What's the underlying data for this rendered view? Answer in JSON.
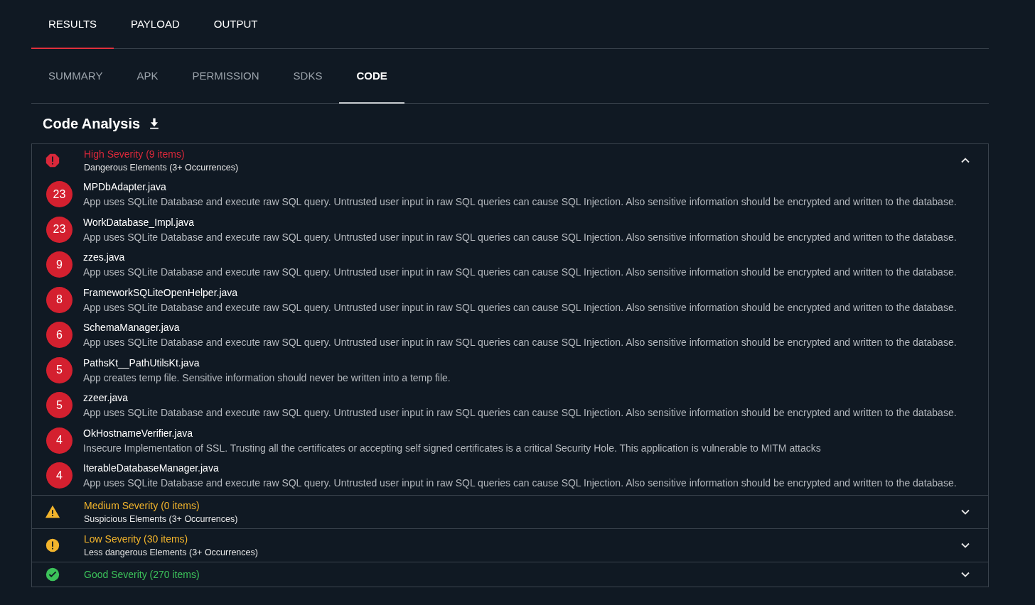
{
  "tabs": [
    {
      "label": "RESULTS",
      "selected": true
    },
    {
      "label": "PAYLOAD",
      "selected": false
    },
    {
      "label": "OUTPUT",
      "selected": false
    }
  ],
  "subtabs": [
    {
      "label": "SUMMARY",
      "selected": false
    },
    {
      "label": "APK",
      "selected": false
    },
    {
      "label": "PERMISSION",
      "selected": false
    },
    {
      "label": "SDKS",
      "selected": false
    },
    {
      "label": "CODE",
      "selected": true
    }
  ],
  "heading": "Code Analysis",
  "sections": [
    {
      "kind": "high",
      "title": "High Severity (9 items)",
      "subtitle": "Dangerous Elements (3+ Occurrences)",
      "color": "#d9283a",
      "expanded": true,
      "items": [
        {
          "count": "23",
          "file": "MPDbAdapter.java",
          "description": "App uses SQLite Database and execute raw SQL query. Untrusted user input in raw SQL queries can cause SQL Injection. Also sensitive information should be encrypted and written to the database."
        },
        {
          "count": "23",
          "file": "WorkDatabase_Impl.java",
          "description": "App uses SQLite Database and execute raw SQL query. Untrusted user input in raw SQL queries can cause SQL Injection. Also sensitive information should be encrypted and written to the database."
        },
        {
          "count": "9",
          "file": "zzes.java",
          "description": "App uses SQLite Database and execute raw SQL query. Untrusted user input in raw SQL queries can cause SQL Injection. Also sensitive information should be encrypted and written to the database."
        },
        {
          "count": "8",
          "file": "FrameworkSQLiteOpenHelper.java",
          "description": "App uses SQLite Database and execute raw SQL query. Untrusted user input in raw SQL queries can cause SQL Injection. Also sensitive information should be encrypted and written to the database."
        },
        {
          "count": "6",
          "file": "SchemaManager.java",
          "description": "App uses SQLite Database and execute raw SQL query. Untrusted user input in raw SQL queries can cause SQL Injection. Also sensitive information should be encrypted and written to the database."
        },
        {
          "count": "5",
          "file": "PathsKt__PathUtilsKt.java",
          "description": "App creates temp file. Sensitive information should never be written into a temp file."
        },
        {
          "count": "5",
          "file": "zzeer.java",
          "description": "App uses SQLite Database and execute raw SQL query. Untrusted user input in raw SQL queries can cause SQL Injection. Also sensitive information should be encrypted and written to the database."
        },
        {
          "count": "4",
          "file": "OkHostnameVerifier.java",
          "description": "Insecure Implementation of SSL. Trusting all the certificates or accepting self signed certificates is a critical Security Hole. This application is vulnerable to MITM attacks"
        },
        {
          "count": "4",
          "file": "IterableDatabaseManager.java",
          "description": "App uses SQLite Database and execute raw SQL query. Untrusted user input in raw SQL queries can cause SQL Injection. Also sensitive information should be encrypted and written to the database."
        }
      ]
    },
    {
      "kind": "medium",
      "title": "Medium Severity (0 items)",
      "subtitle": "Suspicious Elements (3+ Occurrences)",
      "color": "#f2b42c",
      "expanded": false
    },
    {
      "kind": "low",
      "title": "Low Severity (30 items)",
      "subtitle": "Less dangerous Elements (3+ Occurrences)",
      "color": "#f2b42c",
      "expanded": false
    },
    {
      "kind": "good",
      "title": "Good Severity (270 items)",
      "color": "#3cc25a",
      "expanded": false
    }
  ]
}
